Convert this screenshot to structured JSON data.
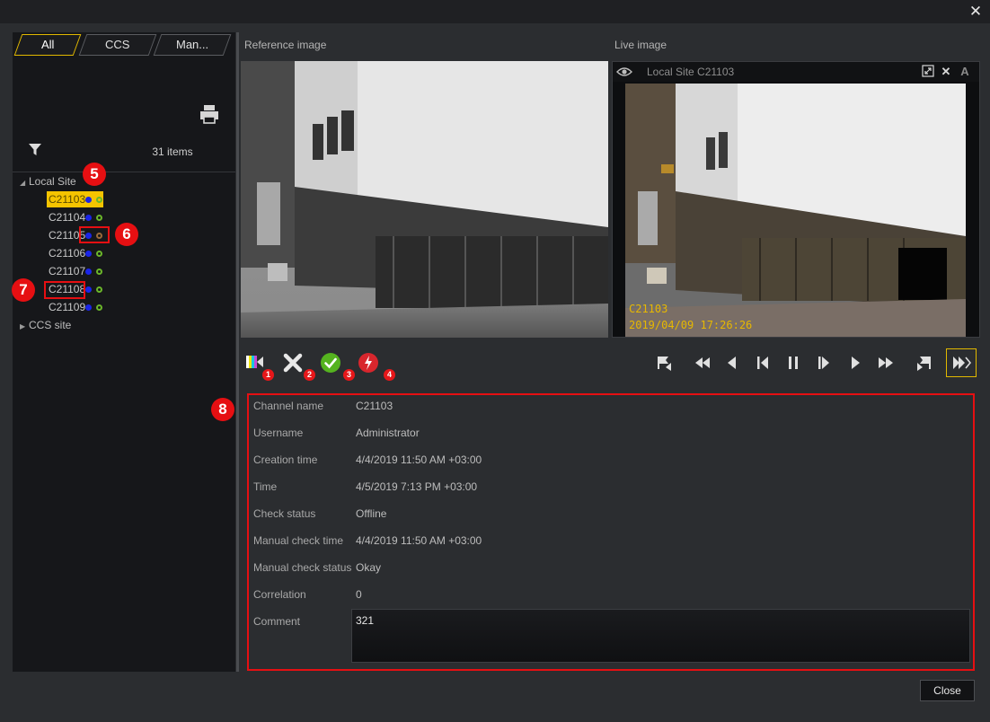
{
  "window": {
    "close_glyph": "✕"
  },
  "tabs": [
    {
      "label": "All",
      "active": true
    },
    {
      "label": "CCS",
      "active": false
    },
    {
      "label": "Man...",
      "active": false
    }
  ],
  "list": {
    "items_count": "31 items",
    "tree": {
      "local_site": "Local Site",
      "cameras": [
        "C21103",
        "C21104",
        "C21105",
        "C21106",
        "C21107",
        "C21108",
        "C21109"
      ],
      "ccs_site": "CCS site"
    }
  },
  "images": {
    "reference_label": "Reference image",
    "live_label": "Live image",
    "live_header_title": "Local Site C21103",
    "osd_name": "C21103",
    "osd_timestamp": "2019/04/09 17:26:26"
  },
  "toolbar_badges": [
    "1",
    "2",
    "3",
    "4"
  ],
  "callouts": [
    "5",
    "6",
    "7",
    "8"
  ],
  "details": {
    "fields": [
      {
        "label": "Channel name",
        "value": "C21103"
      },
      {
        "label": "Username",
        "value": "Administrator"
      },
      {
        "label": "Creation time",
        "value": "4/4/2019 11:50 AM +03:00"
      },
      {
        "label": "Time",
        "value": "4/5/2019 7:13 PM +03:00"
      },
      {
        "label": "Check status",
        "value": "Offline"
      },
      {
        "label": "Manual check time",
        "value": "4/4/2019 11:50 AM +03:00"
      },
      {
        "label": "Manual check status",
        "value": "Okay"
      },
      {
        "label": "Correlation",
        "value": "0"
      }
    ],
    "comment_label": "Comment",
    "comment_value": "321"
  },
  "footer": {
    "close_label": "Close"
  },
  "colors": {
    "accent": "#e2b900",
    "callout_red": "#e60f12",
    "status_blue": "#1a25e8",
    "status_green": "#6bb72a"
  }
}
